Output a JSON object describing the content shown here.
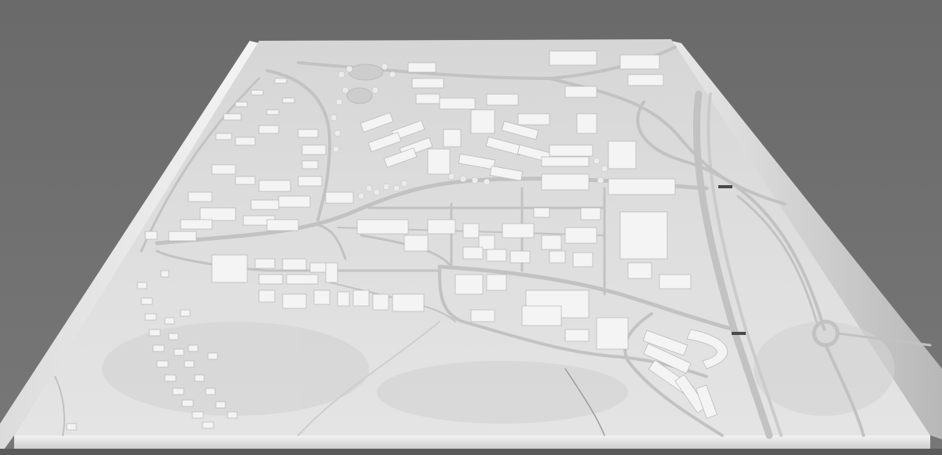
{
  "scene": {
    "subject": "white-architectural-site-model",
    "background_color": "#6e6e6e",
    "model_surface_color": "#dcdcdc",
    "model_edge_color": "#f0f0f0",
    "road_color": "#c4c4c4",
    "building_color": "#f4f4f4",
    "water_color": "#cfcfcf"
  }
}
